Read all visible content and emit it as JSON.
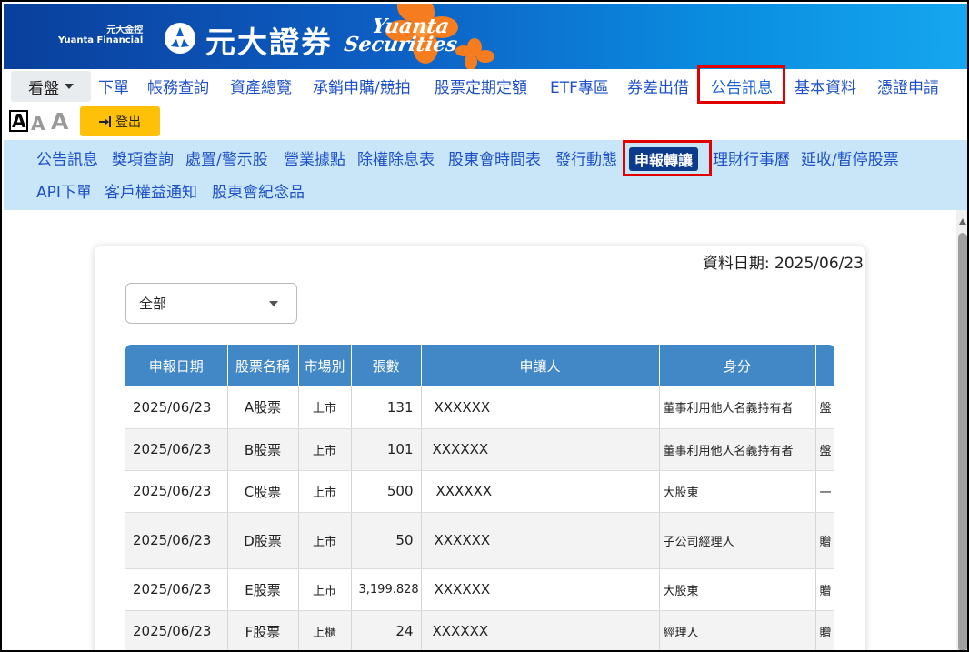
{
  "banner": {
    "holding_cn": "元大金控",
    "holding_en": "Yuanta Financial",
    "brand_cn": "元大證券",
    "brand_en_1": "Yuanta",
    "brand_en_2": "Securities"
  },
  "main_nav": {
    "dropdown": "看盤",
    "items": [
      "下單",
      "帳務查詢",
      "資產總覽",
      "承銷申購/競拍",
      "股票定期定額",
      "ETF專區",
      "券差出借",
      "公告訊息",
      "基本資料",
      "憑證申請"
    ],
    "active": "公告訊息"
  },
  "font_size": {
    "large": "A",
    "medium": "A",
    "small": "A"
  },
  "logout_label": "登出",
  "sub_nav": {
    "row1": [
      "公告訊息",
      "獎項查詢",
      "處置/警示股",
      "營業據點",
      "除權除息表",
      "股東會時間表",
      "發行動態",
      "申報轉讓",
      "理財行事曆",
      "延收/暫停股票"
    ],
    "row2": [
      "API下單",
      "客戶權益通知",
      "股東會紀念品"
    ],
    "active": "申報轉讓"
  },
  "data_date_label": "資料日期: 2025/06/23",
  "filter": {
    "selected": "全部"
  },
  "table": {
    "headers": [
      "申報日期",
      "股票名稱",
      "市場別",
      "張數",
      "申讓人",
      "身分",
      ""
    ],
    "rows": [
      [
        "2025/06/23",
        "A股票",
        "上市",
        "131",
        "XXXXXX",
        "董事利用他人名義持有者",
        "盤"
      ],
      [
        "2025/06/23",
        "B股票",
        "上市",
        "101",
        "XXXXXX",
        "董事利用他人名義持有者",
        "盤"
      ],
      [
        "2025/06/23",
        "C股票",
        "上市",
        "500",
        "XXXXXX",
        "大股東",
        "一"
      ],
      [
        "2025/06/23",
        "D股票",
        "上市",
        "50",
        "XXXXXX",
        "子公司經理人",
        "贈"
      ],
      [
        "2025/06/23",
        "E股票",
        "上市",
        "3,199.828",
        "XXXXXX",
        "大股東",
        "贈"
      ],
      [
        "2025/06/23",
        "F股票",
        "上櫃",
        "24",
        "XXXXXX",
        "經理人",
        "贈"
      ]
    ]
  },
  "colors": {
    "banner": "#0d5fc4",
    "link": "#1e50c8",
    "subnav_bg": "#c8e6f7",
    "active_chip": "#0d3b8c",
    "table_header": "#4287c6",
    "highlight": "#e00000",
    "logout": "#ffc107"
  }
}
